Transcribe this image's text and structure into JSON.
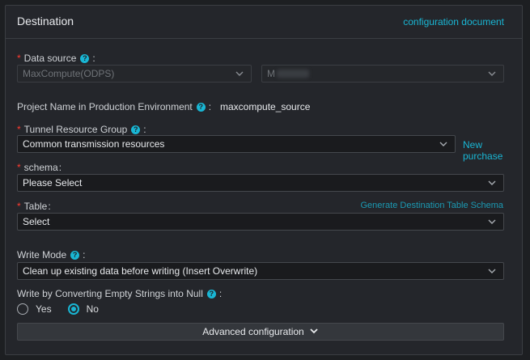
{
  "header": {
    "title": "Destination",
    "doc_link": "configuration document"
  },
  "data_source": {
    "label": "Data source",
    "type_value": "MaxCompute(ODPS)",
    "name_value": "M"
  },
  "project": {
    "label": "Project Name in Production Environment",
    "value": "maxcompute_source"
  },
  "tunnel": {
    "label": "Tunnel Resource Group",
    "value": "Common transmission resources",
    "new_purchase": "New purchase"
  },
  "schema": {
    "label": "schema",
    "placeholder": "Please Select"
  },
  "table": {
    "label": "Table",
    "placeholder": "Select",
    "generate_link": "Generate Destination Table Schema"
  },
  "write_mode": {
    "label": "Write Mode",
    "value": "Clean up existing data before writing (Insert Overwrite)"
  },
  "empty_to_null": {
    "label": "Write by Converting Empty Strings into Null",
    "options": [
      "Yes",
      "No"
    ],
    "selected": "No"
  },
  "advanced": {
    "label": "Advanced configuration"
  },
  "colors": {
    "accent": "#19b6d4",
    "required": "#ff3b30",
    "background": "#24262b"
  }
}
